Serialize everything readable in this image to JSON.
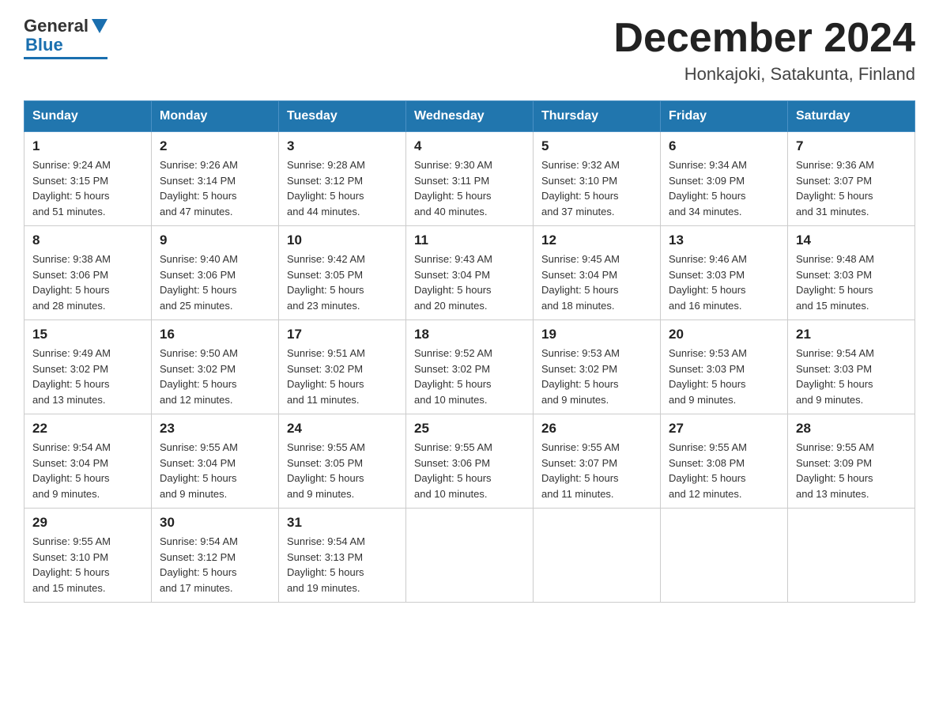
{
  "header": {
    "logo_general": "General",
    "logo_blue": "Blue",
    "month_title": "December 2024",
    "subtitle": "Honkajoki, Satakunta, Finland"
  },
  "weekdays": [
    "Sunday",
    "Monday",
    "Tuesday",
    "Wednesday",
    "Thursday",
    "Friday",
    "Saturday"
  ],
  "weeks": [
    [
      {
        "day": "1",
        "info": "Sunrise: 9:24 AM\nSunset: 3:15 PM\nDaylight: 5 hours\nand 51 minutes."
      },
      {
        "day": "2",
        "info": "Sunrise: 9:26 AM\nSunset: 3:14 PM\nDaylight: 5 hours\nand 47 minutes."
      },
      {
        "day": "3",
        "info": "Sunrise: 9:28 AM\nSunset: 3:12 PM\nDaylight: 5 hours\nand 44 minutes."
      },
      {
        "day": "4",
        "info": "Sunrise: 9:30 AM\nSunset: 3:11 PM\nDaylight: 5 hours\nand 40 minutes."
      },
      {
        "day": "5",
        "info": "Sunrise: 9:32 AM\nSunset: 3:10 PM\nDaylight: 5 hours\nand 37 minutes."
      },
      {
        "day": "6",
        "info": "Sunrise: 9:34 AM\nSunset: 3:09 PM\nDaylight: 5 hours\nand 34 minutes."
      },
      {
        "day": "7",
        "info": "Sunrise: 9:36 AM\nSunset: 3:07 PM\nDaylight: 5 hours\nand 31 minutes."
      }
    ],
    [
      {
        "day": "8",
        "info": "Sunrise: 9:38 AM\nSunset: 3:06 PM\nDaylight: 5 hours\nand 28 minutes."
      },
      {
        "day": "9",
        "info": "Sunrise: 9:40 AM\nSunset: 3:06 PM\nDaylight: 5 hours\nand 25 minutes."
      },
      {
        "day": "10",
        "info": "Sunrise: 9:42 AM\nSunset: 3:05 PM\nDaylight: 5 hours\nand 23 minutes."
      },
      {
        "day": "11",
        "info": "Sunrise: 9:43 AM\nSunset: 3:04 PM\nDaylight: 5 hours\nand 20 minutes."
      },
      {
        "day": "12",
        "info": "Sunrise: 9:45 AM\nSunset: 3:04 PM\nDaylight: 5 hours\nand 18 minutes."
      },
      {
        "day": "13",
        "info": "Sunrise: 9:46 AM\nSunset: 3:03 PM\nDaylight: 5 hours\nand 16 minutes."
      },
      {
        "day": "14",
        "info": "Sunrise: 9:48 AM\nSunset: 3:03 PM\nDaylight: 5 hours\nand 15 minutes."
      }
    ],
    [
      {
        "day": "15",
        "info": "Sunrise: 9:49 AM\nSunset: 3:02 PM\nDaylight: 5 hours\nand 13 minutes."
      },
      {
        "day": "16",
        "info": "Sunrise: 9:50 AM\nSunset: 3:02 PM\nDaylight: 5 hours\nand 12 minutes."
      },
      {
        "day": "17",
        "info": "Sunrise: 9:51 AM\nSunset: 3:02 PM\nDaylight: 5 hours\nand 11 minutes."
      },
      {
        "day": "18",
        "info": "Sunrise: 9:52 AM\nSunset: 3:02 PM\nDaylight: 5 hours\nand 10 minutes."
      },
      {
        "day": "19",
        "info": "Sunrise: 9:53 AM\nSunset: 3:02 PM\nDaylight: 5 hours\nand 9 minutes."
      },
      {
        "day": "20",
        "info": "Sunrise: 9:53 AM\nSunset: 3:03 PM\nDaylight: 5 hours\nand 9 minutes."
      },
      {
        "day": "21",
        "info": "Sunrise: 9:54 AM\nSunset: 3:03 PM\nDaylight: 5 hours\nand 9 minutes."
      }
    ],
    [
      {
        "day": "22",
        "info": "Sunrise: 9:54 AM\nSunset: 3:04 PM\nDaylight: 5 hours\nand 9 minutes."
      },
      {
        "day": "23",
        "info": "Sunrise: 9:55 AM\nSunset: 3:04 PM\nDaylight: 5 hours\nand 9 minutes."
      },
      {
        "day": "24",
        "info": "Sunrise: 9:55 AM\nSunset: 3:05 PM\nDaylight: 5 hours\nand 9 minutes."
      },
      {
        "day": "25",
        "info": "Sunrise: 9:55 AM\nSunset: 3:06 PM\nDaylight: 5 hours\nand 10 minutes."
      },
      {
        "day": "26",
        "info": "Sunrise: 9:55 AM\nSunset: 3:07 PM\nDaylight: 5 hours\nand 11 minutes."
      },
      {
        "day": "27",
        "info": "Sunrise: 9:55 AM\nSunset: 3:08 PM\nDaylight: 5 hours\nand 12 minutes."
      },
      {
        "day": "28",
        "info": "Sunrise: 9:55 AM\nSunset: 3:09 PM\nDaylight: 5 hours\nand 13 minutes."
      }
    ],
    [
      {
        "day": "29",
        "info": "Sunrise: 9:55 AM\nSunset: 3:10 PM\nDaylight: 5 hours\nand 15 minutes."
      },
      {
        "day": "30",
        "info": "Sunrise: 9:54 AM\nSunset: 3:12 PM\nDaylight: 5 hours\nand 17 minutes."
      },
      {
        "day": "31",
        "info": "Sunrise: 9:54 AM\nSunset: 3:13 PM\nDaylight: 5 hours\nand 19 minutes."
      },
      null,
      null,
      null,
      null
    ]
  ]
}
